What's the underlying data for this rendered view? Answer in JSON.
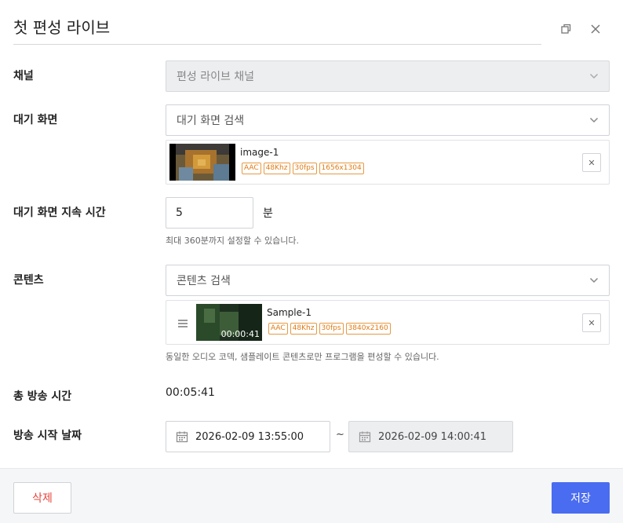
{
  "modal": {
    "title": "첫 편성 라이브"
  },
  "icons": {
    "popout": "popout-icon",
    "close": "close-icon",
    "chevron": "chevron-down-icon",
    "drag": "drag-handle-icon",
    "calendar": "calendar-icon",
    "remove": "remove-icon"
  },
  "form": {
    "channel": {
      "label": "채널",
      "value": "편성 라이브 채널"
    },
    "standby_screen": {
      "label": "대기 화면",
      "placeholder": "대기 화면 검색",
      "item": {
        "name": "image-1",
        "badges": [
          "AAC",
          "48Khz",
          "30fps",
          "1656x1304"
        ]
      }
    },
    "standby_duration": {
      "label": "대기 화면 지속 시간",
      "value": "5",
      "unit": "분",
      "helper": "최대 360분까지 설정할 수 있습니다."
    },
    "contents": {
      "label": "콘텐츠",
      "placeholder": "콘텐츠 검색",
      "item": {
        "name": "Sample-1",
        "duration": "00:00:41",
        "badges": [
          "AAC",
          "48Khz",
          "30fps",
          "3840x2160"
        ]
      },
      "helper": "동일한 오디오 코덱, 샘플레이트 콘텐츠로만 프로그램을 편성할 수 있습니다."
    },
    "total_time": {
      "label": "총 방송 시간",
      "value": "00:05:41"
    },
    "start_date": {
      "label": "방송 시작 날짜",
      "start": "2026-02-09 13:55:00",
      "separator": "~",
      "end": "2026-02-09 14:00:41"
    }
  },
  "footer": {
    "delete_label": "삭제",
    "save_label": "저장"
  },
  "colors": {
    "accent": "#4a6cf0",
    "danger": "#e5463c",
    "badge": "#e07a12"
  }
}
